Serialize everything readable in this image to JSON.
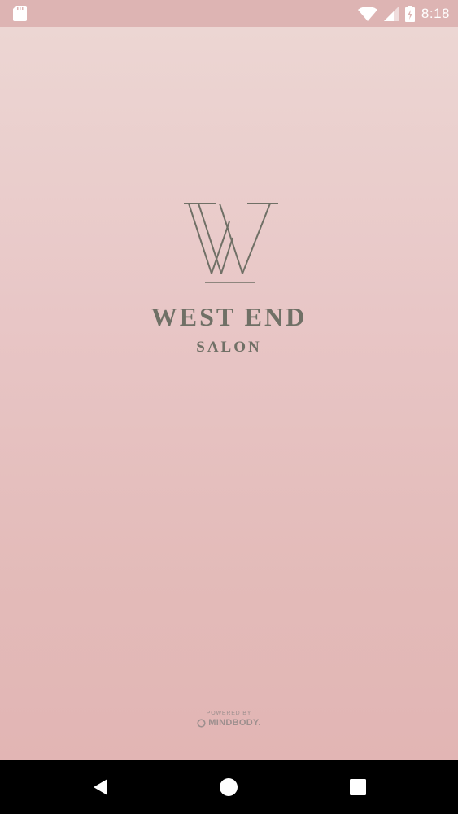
{
  "status_bar": {
    "time": "8:18",
    "icons": [
      "sd-card-icon",
      "wifi-icon",
      "signal-icon",
      "battery-charging-icon"
    ]
  },
  "splash": {
    "logo_letter": "W",
    "title": "WEST END",
    "subtitle": "SALON",
    "powered_by": "POWERED BY",
    "powered_brand": "MINDBODY."
  },
  "nav_bar": {
    "buttons": [
      "back",
      "home",
      "recent-apps"
    ]
  },
  "colors": {
    "status_bar_bg": "#ddb4b3",
    "background_top": "#ecd6d3",
    "background_bottom": "#e2b5b4",
    "logo_text": "#707066",
    "nav_bar_bg": "#000000"
  }
}
